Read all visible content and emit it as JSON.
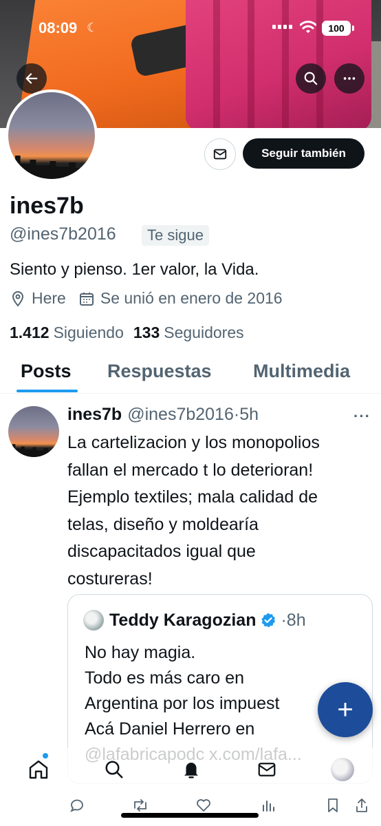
{
  "status_bar": {
    "time": "08:09",
    "battery": "100"
  },
  "profile": {
    "display_name": "ines7b",
    "handle": "@ines7b2016",
    "follows_you": "Te sigue",
    "bio": "Siento y pienso. 1er valor, la Vida.",
    "location": "Here",
    "joined": "Se unió en enero de 2016",
    "following_count": "1.412",
    "following_label": "Siguiendo",
    "followers_count": "133",
    "followers_label": "Seguidores",
    "follow_button": "Seguir también"
  },
  "tabs": [
    {
      "label": "Posts",
      "active": true
    },
    {
      "label": "Respuestas",
      "active": false
    },
    {
      "label": "Multimedia",
      "active": false
    }
  ],
  "post": {
    "name": "ines7b",
    "handle": "@ines7b2016",
    "separator": "·",
    "time": "5h",
    "more": "···",
    "lines": [
      "La cartelizacion y los monopolios",
      "fallan el mercado t lo deterioran!",
      "Ejemplo textiles; mala calidad de",
      "telas, diseño y moldearía",
      "discapacitados igual que",
      "costureras!"
    ]
  },
  "quote": {
    "name": "Teddy Karagozian",
    "separator": "·",
    "time": "8h",
    "lines": [
      "No hay magia.",
      "Todo es más caro en",
      "Argentina por los impuest",
      "Acá Daniel Herrero en",
      "@lafabricapodc x.com/lafa..."
    ]
  },
  "fab": {
    "label": "+"
  },
  "colors": {
    "accent": "#1d9bf0",
    "fab": "#1d4d9a",
    "verified": "#1d9bf0",
    "text": "#0f1419",
    "secondary": "#536471"
  },
  "bottom_nav": [
    "home-icon",
    "search-icon",
    "notifications-icon",
    "messages-icon",
    "profile-avatar"
  ],
  "post_actions": [
    "reply-icon",
    "repost-icon",
    "like-icon",
    "views-icon",
    "bookmark-icon",
    "share-icon"
  ]
}
